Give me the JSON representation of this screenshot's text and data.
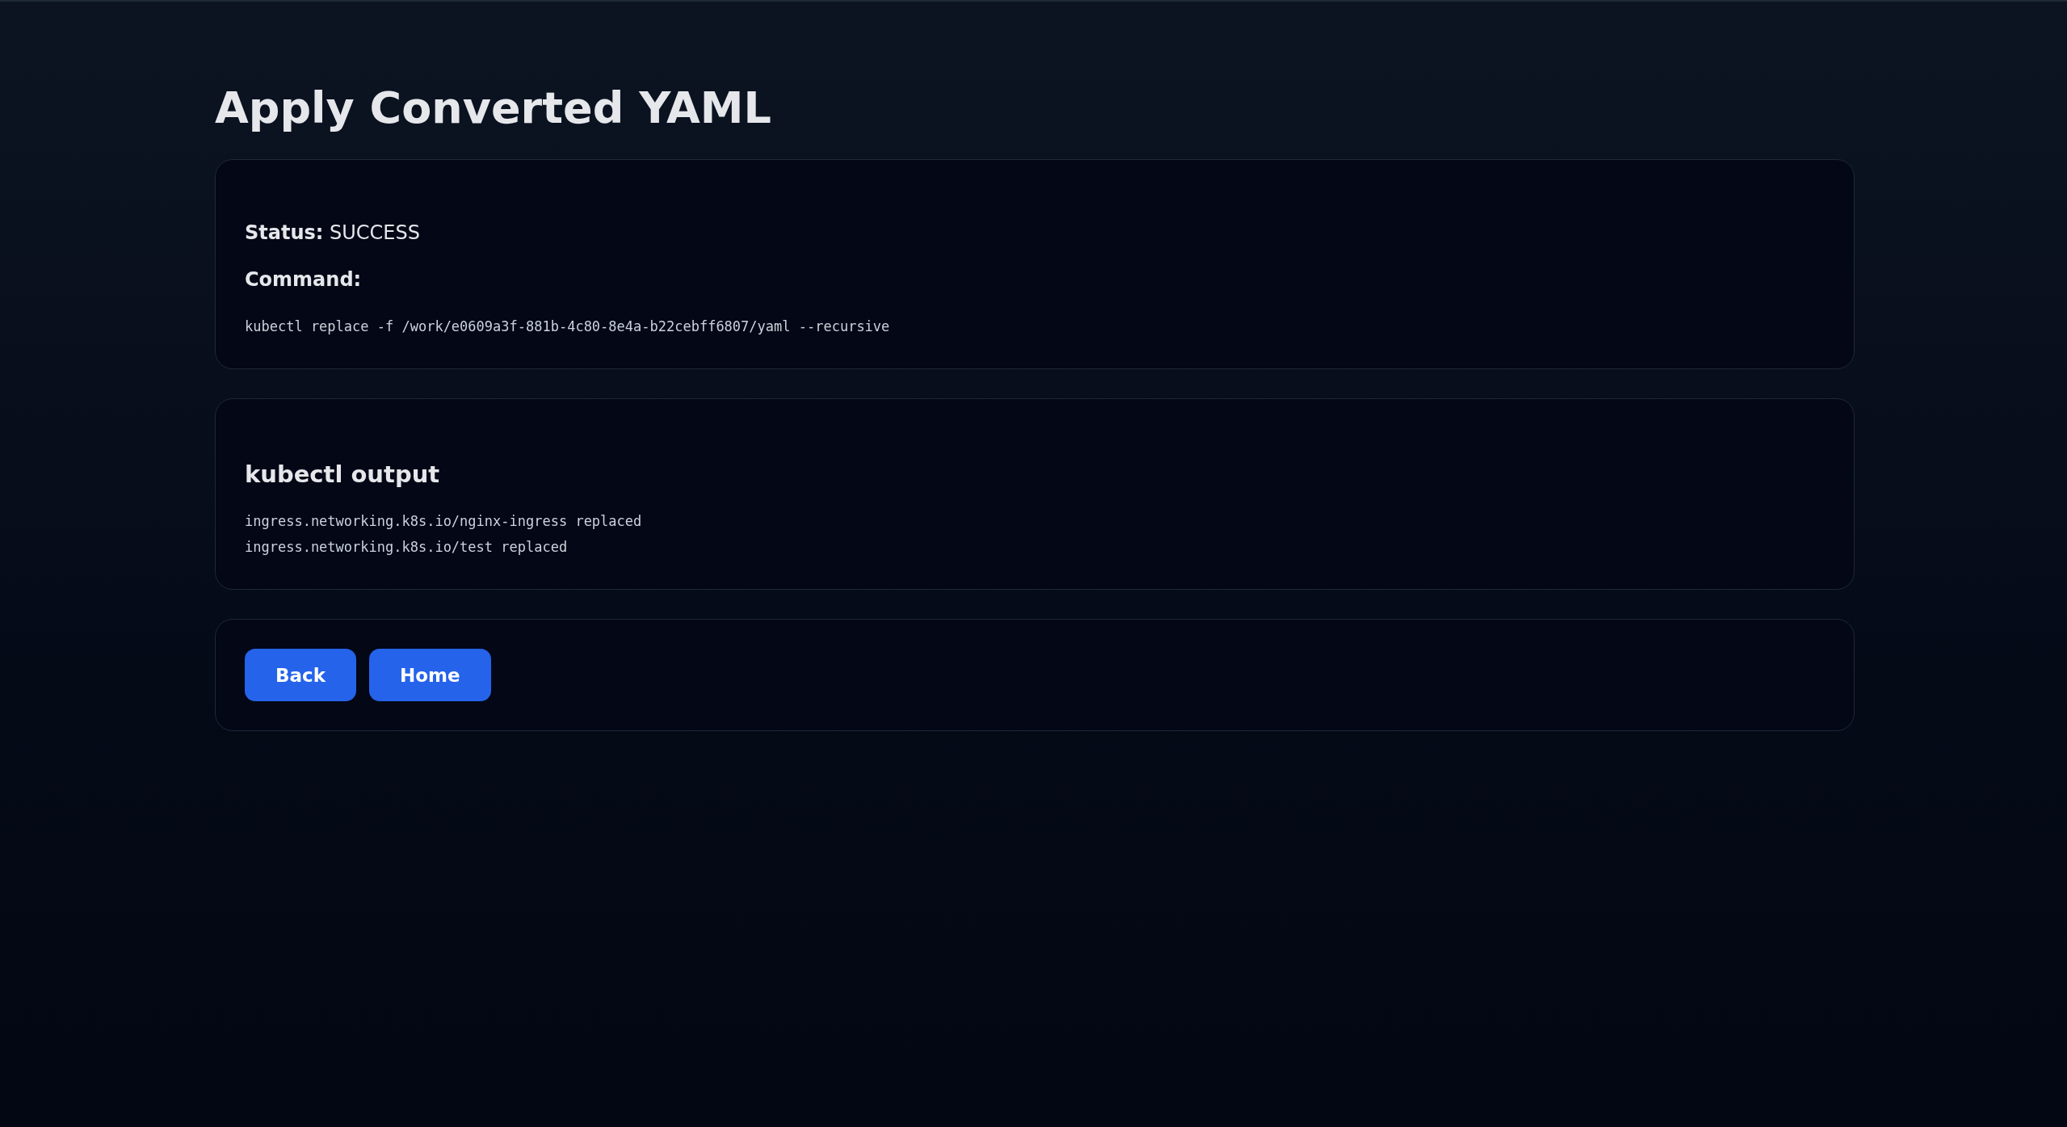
{
  "page": {
    "title": "Apply Converted YAML"
  },
  "result": {
    "status": "**Status:** SUCCESS",
    "command_label": "Command:",
    "command": "kubectl replace -f /work/e0609a3f-881b-4c80-8e4a-b22cebff6807/yaml --recursive"
  },
  "output": {
    "heading": "kubectl output",
    "lines": [
      "ingress.networking.k8s.io/nginx-ingress replaced",
      "ingress.networking.k8s.io/test replaced"
    ]
  },
  "buttons": [
    "Back",
    "Home"
  ]
}
